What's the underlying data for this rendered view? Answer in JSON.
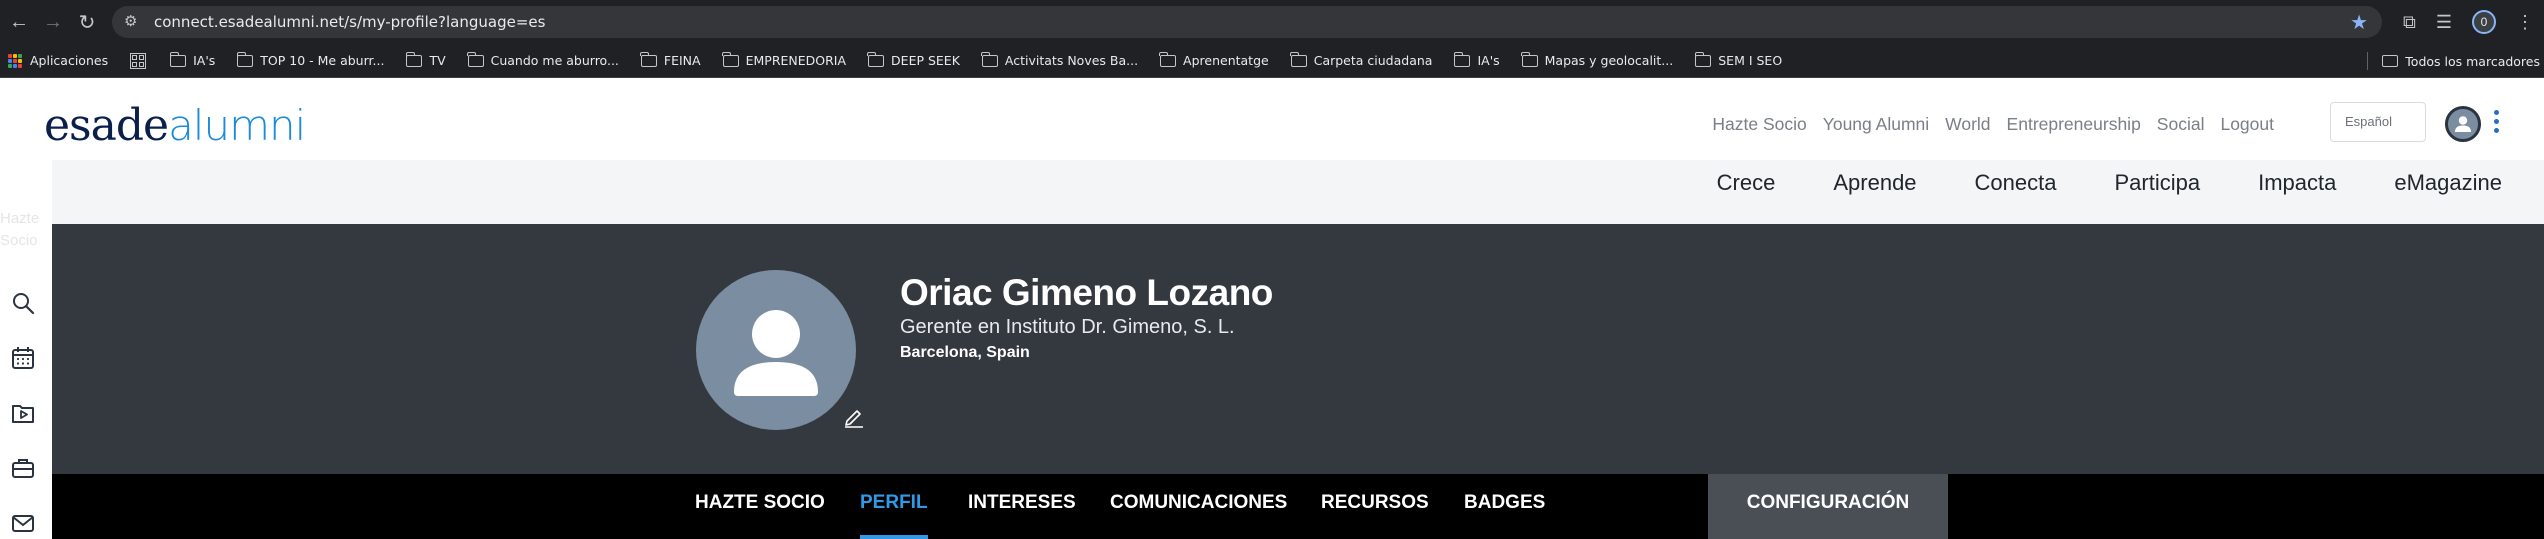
{
  "browser": {
    "url": "connect.esadealumni.net/s/my-profile?language=es",
    "profile_initial": "0",
    "bookmarks": [
      "TOP 10 - Me aburr...",
      "TV",
      "Cuando me aburro...",
      "FEINA",
      "EMPRENEDORIA",
      "DEEP SEEK",
      "Activitats Noves Ba...",
      "Aprenentatge",
      "Carpeta ciudadana",
      "IA's",
      "Mapas y geolocalit...",
      "SEM I SEO"
    ],
    "apps_label": "Aplicaciones",
    "first_bookmark": "IA's",
    "all_bookmarks_label": "Todos los marcadores"
  },
  "site": {
    "logo_part1": "esade",
    "logo_part2": "alumni",
    "top_links": [
      "Hazte Socio",
      "Young Alumni",
      "World",
      "Entrepreneurship",
      "Social",
      "Logout"
    ],
    "language_placeholder": "Español",
    "main_nav": [
      "Crece",
      "Aprende",
      "Conecta",
      "Participa",
      "Impacta",
      "eMagazine"
    ],
    "rail_ghost": [
      "Hazte",
      "Socio"
    ]
  },
  "profile": {
    "name": "Oriac Gimeno Lozano",
    "job": "Gerente en Instituto Dr. Gimeno, S. L.",
    "location": "Barcelona, Spain"
  },
  "tabs": {
    "hazte_socio": "HAZTE SOCIO",
    "perfil": "PERFIL",
    "intereses": "INTERESES",
    "comunicaciones": "COMUNICACIONES",
    "recursos": "RECURSOS",
    "badges": "BADGES",
    "configuracion": "CONFIGURACIÓN"
  },
  "colors": {
    "brand_navy": "#0b1f4d",
    "brand_blue": "#1c8ad8",
    "active_tab": "#2f9ae9",
    "hero_bg": "#34383f"
  }
}
